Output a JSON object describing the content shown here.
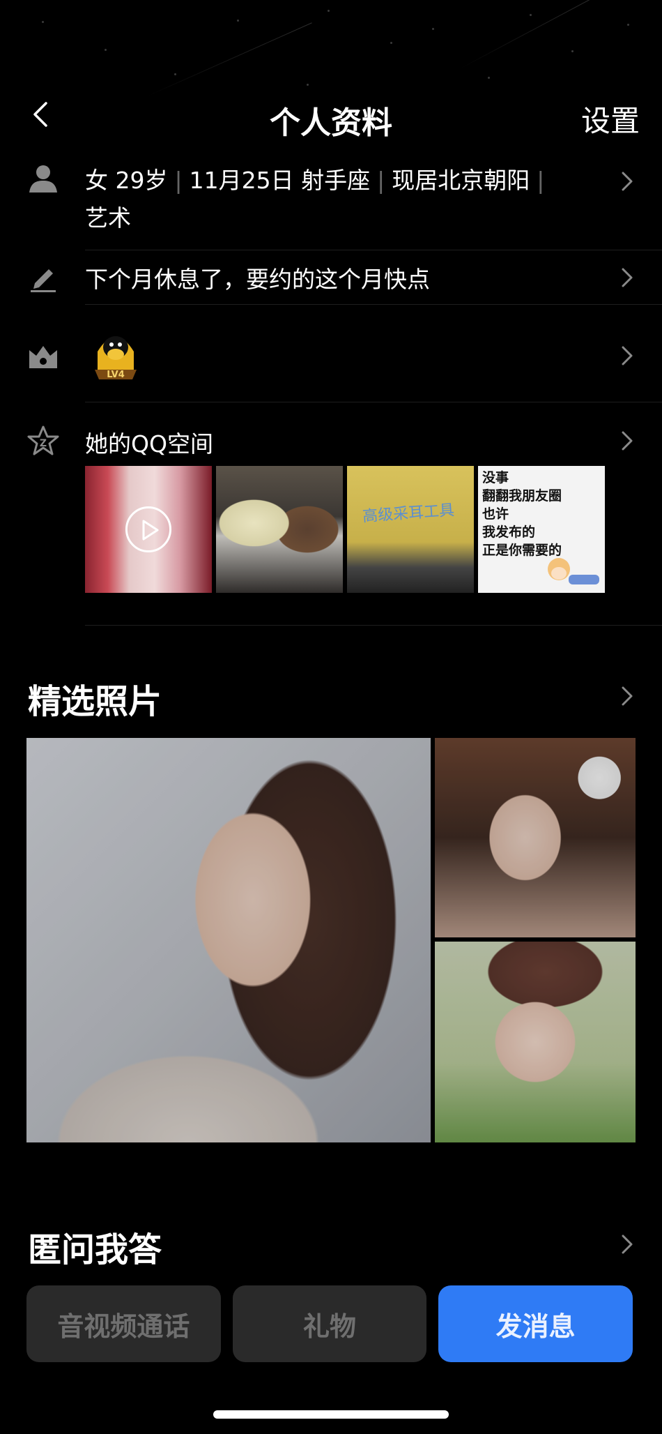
{
  "header": {
    "title": "个人资料",
    "settings_label": "设置"
  },
  "profile_info": {
    "gender": "女",
    "age": "29岁",
    "birthday": "11月25日",
    "zodiac": "射手座",
    "location": "现居北京朝阳",
    "occupation": "艺术",
    "separator": "|"
  },
  "signature": {
    "text": "下个月休息了，要约的这个月快点"
  },
  "level_badge": {
    "text": "LV4",
    "icon": "qq-penguin-level-badge"
  },
  "qzone": {
    "title": "她的QQ空间",
    "thumb3_caption": "高级采耳工具",
    "thumb4_lines": [
      "没事",
      "翻翻我朋友圈",
      "也许",
      "我发布的",
      "正是你需要的"
    ]
  },
  "photos": {
    "title": "精选照片"
  },
  "qa": {
    "title": "匿问我答"
  },
  "actions": {
    "call_label": "音视频通话",
    "gift_label": "礼物",
    "message_label": "发消息"
  },
  "colors": {
    "accent": "#2f7bf5",
    "background": "#000000",
    "button_bg": "#2a2a2a",
    "muted_text": "#6f6f6f"
  }
}
